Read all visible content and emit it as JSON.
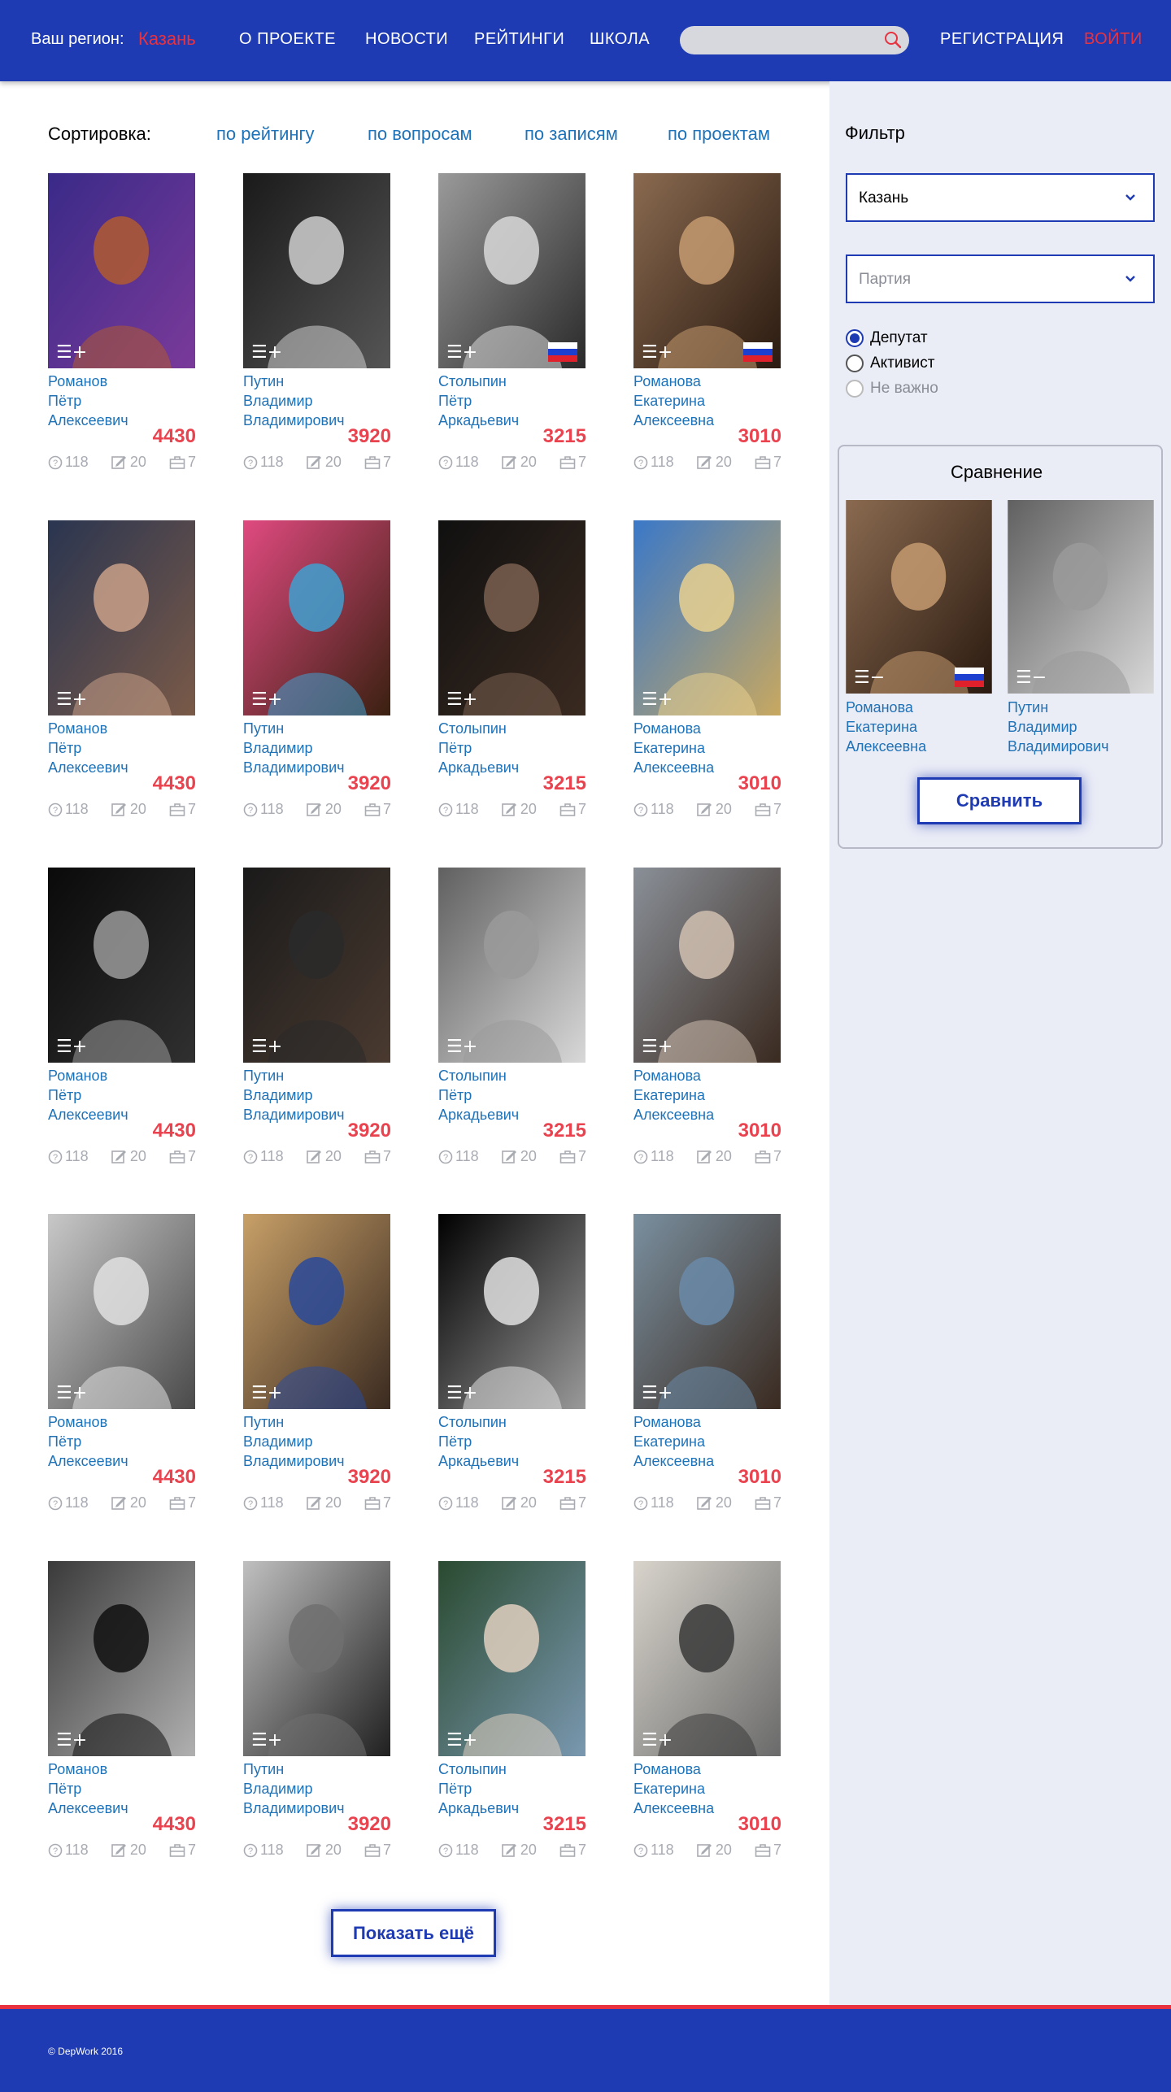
{
  "header": {
    "region_label": "Ваш регион:",
    "region_value": "Казань",
    "nav": [
      "О ПРОЕКТЕ",
      "НОВОСТИ",
      "РЕЙТИНГИ",
      "ШКОЛА"
    ],
    "search_placeholder": "",
    "register": "РЕГИСТРАЦИЯ",
    "login": "ВОЙТИ"
  },
  "sort": {
    "label": "Сортировка:",
    "options": [
      "по рейтингу",
      "по вопросам",
      "по записям",
      "по проектам"
    ]
  },
  "people": [
    {
      "name": [
        "Романов",
        "Пётр",
        "Алексеевич"
      ],
      "rating": "4430",
      "questions": "118",
      "posts": "20",
      "projects": "7"
    },
    {
      "name": [
        "Путин",
        "Владимир",
        "Владимирович"
      ],
      "rating": "3920",
      "questions": "118",
      "posts": "20",
      "projects": "7"
    },
    {
      "name": [
        "Столыпин",
        "Пётр",
        "Аркадьевич"
      ],
      "rating": "3215",
      "questions": "118",
      "posts": "20",
      "projects": "7"
    },
    {
      "name": [
        "Романова",
        "Екатерина",
        "Алексеевна"
      ],
      "rating": "3010",
      "questions": "118",
      "posts": "20",
      "projects": "7"
    }
  ],
  "cards": [
    {
      "p": 0,
      "ctrl": "☰+",
      "flag": false,
      "tone": [
        "#3a2a88",
        "#7a3a9a",
        "#b05a30"
      ]
    },
    {
      "p": 1,
      "ctrl": "☰+",
      "flag": false,
      "tone": [
        "#1a1a1a",
        "#555555",
        "#cfcfcf"
      ]
    },
    {
      "p": 2,
      "ctrl": "☰+",
      "flag": true,
      "tone": [
        "#9a9a9a",
        "#2a2a2a",
        "#d8d8d8"
      ]
    },
    {
      "p": 3,
      "ctrl": "☰+",
      "flag": true,
      "tone": [
        "#8a6a50",
        "#2a1a10",
        "#c49a70"
      ]
    },
    {
      "p": 0,
      "ctrl": "☰+",
      "flag": false,
      "tone": [
        "#2a3550",
        "#7a5a48",
        "#c9a088"
      ]
    },
    {
      "p": 1,
      "ctrl": "☰+",
      "flag": false,
      "tone": [
        "#e04a80",
        "#3a2010",
        "#40a0d0"
      ]
    },
    {
      "p": 2,
      "ctrl": "☰+",
      "flag": false,
      "tone": [
        "#101010",
        "#3a2a20",
        "#7a6050"
      ]
    },
    {
      "p": 3,
      "ctrl": "☰+",
      "flag": false,
      "tone": [
        "#3a78c8",
        "#c8a860",
        "#e8d090"
      ]
    },
    {
      "p": 0,
      "ctrl": "☰+",
      "flag": false,
      "tone": [
        "#0a0a0a",
        "#303030",
        "#9a9a9a"
      ]
    },
    {
      "p": 1,
      "ctrl": "☰+",
      "flag": false,
      "tone": [
        "#1a1a1a",
        "#4a3a30",
        "#2a2a2a"
      ]
    },
    {
      "p": 2,
      "ctrl": "☰+",
      "flag": false,
      "tone": [
        "#606060",
        "#d8d8d8",
        "#9a9a9a"
      ]
    },
    {
      "p": 3,
      "ctrl": "☰+",
      "flag": false,
      "tone": [
        "#8a9098",
        "#3a2a20",
        "#d0c0b0"
      ]
    },
    {
      "p": 0,
      "ctrl": "☰+",
      "flag": false,
      "tone": [
        "#c8c8c8",
        "#4a4a4a",
        "#e0e0e0"
      ]
    },
    {
      "p": 1,
      "ctrl": "☰+",
      "flag": false,
      "tone": [
        "#c8a068",
        "#3a2a20",
        "#2a4a9a"
      ]
    },
    {
      "p": 2,
      "ctrl": "☰+",
      "flag": false,
      "tone": [
        "#000000",
        "#9a9a9a",
        "#e0e0e0"
      ]
    },
    {
      "p": 3,
      "ctrl": "☰+",
      "flag": false,
      "tone": [
        "#7a90a0",
        "#3a2a20",
        "#6a8aa8"
      ]
    },
    {
      "p": 0,
      "ctrl": "☰+",
      "flag": false,
      "tone": [
        "#3a3a3a",
        "#b0b0b0",
        "#101010"
      ]
    },
    {
      "p": 1,
      "ctrl": "☰+",
      "flag": false,
      "tone": [
        "#c0c0c0",
        "#202020",
        "#707070"
      ]
    },
    {
      "p": 2,
      "ctrl": "☰+",
      "flag": false,
      "tone": [
        "#2a4a30",
        "#7a98b0",
        "#e0d0c0"
      ]
    },
    {
      "p": 3,
      "ctrl": "☰+",
      "flag": false,
      "tone": [
        "#d8d4cc",
        "#6a6a6a",
        "#3a3a3a"
      ]
    }
  ],
  "more_button": "Показать ещё",
  "filter": {
    "title": "Фильтр",
    "city": "Казань",
    "party_placeholder": "Партия",
    "radios": [
      "Депутат",
      "Активист",
      "Не важно"
    ],
    "selected": "Депутат"
  },
  "compare": {
    "title": "Сравнение",
    "items": [
      {
        "name": [
          "Романова",
          "Екатерина",
          "Алексеевна"
        ],
        "ctrl": "☰−",
        "flag": true,
        "tone": [
          "#8a6a50",
          "#2a1a10",
          "#c49a70"
        ]
      },
      {
        "name": [
          "Путин",
          "Владимир",
          "Владимирович"
        ],
        "ctrl": "☰−",
        "flag": false,
        "tone": [
          "#606060",
          "#d8d8d8",
          "#9a9a9a"
        ]
      }
    ],
    "button": "Сравнить"
  },
  "footer": {
    "copyright": "© DepWork 2016"
  },
  "colors": {
    "brand_blue": "#1f3bb3",
    "accent_red": "#e8323f",
    "link": "#1e72b8",
    "rating": "#e8434f",
    "sidebar_bg": "#eaecf6"
  },
  "icons": [
    "search-icon",
    "chevron-down-icon",
    "question-icon",
    "edit-icon",
    "briefcase-icon",
    "list-add-icon",
    "list-remove-icon",
    "russia-flag-icon"
  ]
}
